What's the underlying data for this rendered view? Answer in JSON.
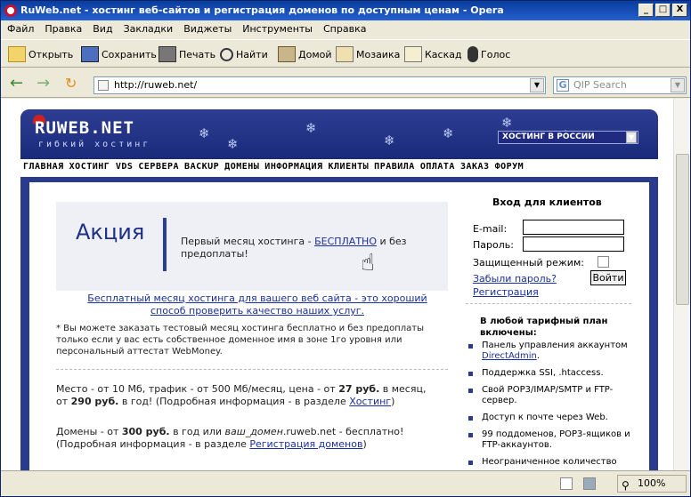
{
  "window": {
    "title": "RuWeb.net - хостинг веб-сайтов и регистрация доменов по доступным ценам - Opera",
    "min": "_",
    "max": "□",
    "close": "X"
  },
  "menu": [
    "Файл",
    "Правка",
    "Вид",
    "Закладки",
    "Виджеты",
    "Инструменты",
    "Справка"
  ],
  "toolbar": {
    "open": "Открыть",
    "save": "Сохранить",
    "print": "Печать",
    "find": "Найти",
    "home": "Домой",
    "tile": "Мозаика",
    "cascade": "Каскад",
    "voice": "Голос"
  },
  "address": {
    "url": "http://ruweb.net/",
    "search_placeholder": "QIP Search"
  },
  "site": {
    "logo": "RUWEB.NET",
    "tagline": "гибкий хостинг",
    "hosting_select": "ХОСТИНГ В РОССИИ",
    "nav": [
      "ГЛАВНАЯ",
      "ХОСТИНГ VDS",
      "СЕРВЕРА",
      "BACKUP",
      "ДОМЕНЫ",
      "ИНФОРМАЦИЯ",
      "КЛИЕНТЫ",
      "ПРАВИЛА",
      "ОПЛАТА",
      "ЗАКАЗ",
      "ФОРУМ"
    ],
    "promo": {
      "title": "Акция",
      "text_before": "Первый месяц хостинга - ",
      "link": "БЕСПЛАТНО",
      "text_after": " и без предоплаты!"
    },
    "free_link": "Бесплатный месяц хостинга для вашего веб сайта - это хороший способ проверить качество наших услуг.",
    "note": "* Вы можете заказать тестовый месяц хостинга бесплатно и без предоплаты только если у вас есть собственное доменное имя в зоне 1го уровня или персональный аттестат WebMoney.",
    "para1": {
      "p1": "Место - от 10 Мб, трафик - от 500 Мб/месяц, цена - от ",
      "price1": "27 руб.",
      "p2": " в месяц, от ",
      "price2": "290 руб.",
      "p3": " в год! (Подробная информация - в разделе ",
      "link": "Хостинг",
      "p4": ")"
    },
    "para2": {
      "p1": "Домены - от ",
      "price": "300 руб.",
      "p2": " в год или ",
      "italic": "ваш_домен",
      "p3": ".ruweb.net - бесплатно! (Подробная информация - в разделе ",
      "link": "Регистрация доменов",
      "p4": ")"
    },
    "login": {
      "title": "Вход для клиентов",
      "email": "E-mail:",
      "password": "Пароль:",
      "secure": "Защищенный режим:",
      "forgot": "Забыли пароль?",
      "register": "Регистрация",
      "button": "Войти"
    },
    "plan": {
      "title": "В любой тарифный план включены:",
      "items": [
        "Панель управления аккаунтом ",
        "Поддержка SSI, .htaccess.",
        "Свой POP3/IMAP/SMTP и FTP-сервер.",
        "Доступ к почте через Web.",
        "99 поддоменов, POP3-ящиков и FTP-аккаунтов.",
        "Неограниченное количество"
      ],
      "item0_link": "DirectAdmin",
      "item0_end": "."
    }
  },
  "status": {
    "zoom": "100%"
  }
}
